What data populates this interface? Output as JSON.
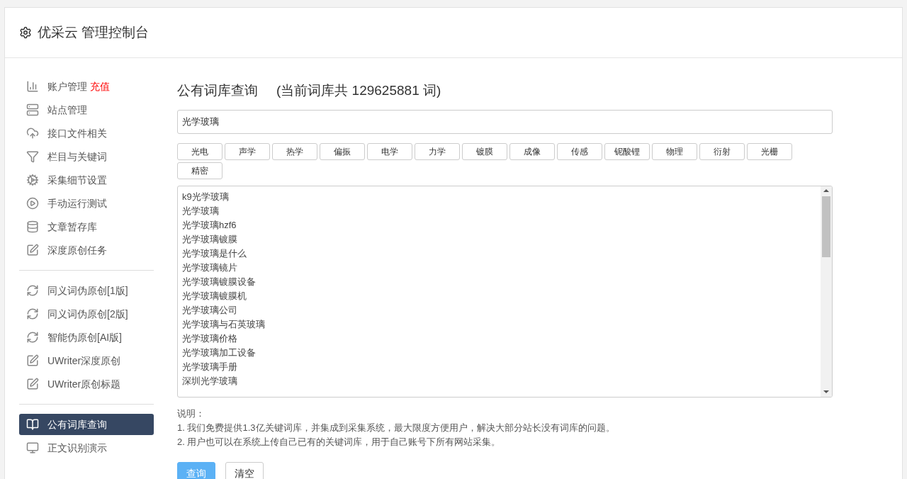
{
  "header": {
    "title": "优采云 管理控制台"
  },
  "sidebar": {
    "groups": [
      {
        "items": [
          {
            "label": "账户管理",
            "badge": "充值",
            "selected": false
          },
          {
            "label": "站点管理",
            "selected": false
          },
          {
            "label": "接口文件相关",
            "selected": false
          },
          {
            "label": "栏目与关键词",
            "selected": false
          },
          {
            "label": "采集细节设置",
            "selected": false
          },
          {
            "label": "手动运行测试",
            "selected": false
          },
          {
            "label": "文章暂存库",
            "selected": false
          },
          {
            "label": "深度原创任务",
            "selected": false
          }
        ]
      },
      {
        "items": [
          {
            "label": "同义词伪原创[1版]",
            "selected": false
          },
          {
            "label": "同义词伪原创[2版]",
            "selected": false
          },
          {
            "label": "智能伪原创[AI版]",
            "selected": false
          },
          {
            "label": "UWriter深度原创",
            "selected": false
          },
          {
            "label": "UWriter原创标题",
            "selected": false
          }
        ]
      },
      {
        "items": [
          {
            "label": "公有词库查询",
            "selected": true
          },
          {
            "label": "正文识别演示",
            "selected": false
          }
        ]
      }
    ]
  },
  "main": {
    "title": "公有词库查询",
    "count_note": "(当前词库共 129625881 词)",
    "search": {
      "value": "光学玻璃"
    },
    "tags": [
      "光电",
      "声学",
      "热学",
      "偏振",
      "电学",
      "力学",
      "镀膜",
      "成像",
      "传感",
      "铌酸锂",
      "物理",
      "衍射",
      "光栅",
      "精密"
    ],
    "results": [
      "k9光学玻璃",
      "光学玻璃",
      "光学玻璃hzf6",
      "光学玻璃镀膜",
      "光学玻璃是什么",
      "光学玻璃镜片",
      "光学玻璃镀膜设备",
      "光学玻璃镀膜机",
      "光学玻璃公司",
      "光学玻璃与石英玻璃",
      "光学玻璃价格",
      "光学玻璃加工设备",
      "光学玻璃手册",
      "深圳光学玻璃"
    ],
    "notes_title": "说明：",
    "notes": [
      "1. 我们免费提供1.3亿关键词库，并集成到采集系统，最大限度方便用户，解决大部分站长没有词库的问题。",
      "2. 用户也可以在系统上传自己已有的关键词库，用于自己账号下所有网站采集。"
    ],
    "buttons": [
      {
        "label": "查询",
        "kind": "primary"
      },
      {
        "label": "清空",
        "kind": "default"
      }
    ]
  }
}
